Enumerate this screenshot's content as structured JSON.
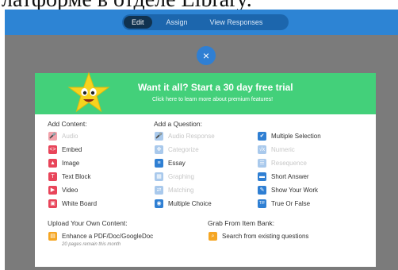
{
  "caption": "латформе в отделе Library.",
  "topbar": {
    "tabs": [
      {
        "label": "Edit",
        "active": true
      },
      {
        "label": "Assign",
        "active": false
      },
      {
        "label": "View Responses",
        "active": false
      }
    ]
  },
  "close_icon": "×",
  "banner": {
    "title": "Want it all? Start a 30 day free trial",
    "subtitle": "Click here to learn more about premium features!",
    "color": "#43d07a"
  },
  "add_content": {
    "label": "Add Content:",
    "items": [
      {
        "label": "Audio",
        "icon": "microphone-icon",
        "glyph": "🎤",
        "disabled": true
      },
      {
        "label": "Embed",
        "icon": "code-icon",
        "glyph": "<>",
        "disabled": false
      },
      {
        "label": "Image",
        "icon": "image-icon",
        "glyph": "▲",
        "disabled": false
      },
      {
        "label": "Text Block",
        "icon": "text-icon",
        "glyph": "T",
        "disabled": false
      },
      {
        "label": "Video",
        "icon": "play-icon",
        "glyph": "▶",
        "disabled": false
      },
      {
        "label": "White Board",
        "icon": "whiteboard-icon",
        "glyph": "▣",
        "disabled": false
      }
    ]
  },
  "add_question": {
    "label": "Add a Question:",
    "col1": [
      {
        "label": "Audio Response",
        "icon": "microphone-icon",
        "glyph": "🎤",
        "disabled": true
      },
      {
        "label": "Categorize",
        "icon": "categorize-icon",
        "glyph": "✥",
        "disabled": true
      },
      {
        "label": "Essay",
        "icon": "essay-icon",
        "glyph": "≡",
        "disabled": false
      },
      {
        "label": "Graphing",
        "icon": "graph-icon",
        "glyph": "▦",
        "disabled": true
      },
      {
        "label": "Matching",
        "icon": "matching-icon",
        "glyph": "⇄",
        "disabled": true
      },
      {
        "label": "Multiple Choice",
        "icon": "radio-icon",
        "glyph": "◉",
        "disabled": false
      }
    ],
    "col2": [
      {
        "label": "Multiple Selection",
        "icon": "checkbox-icon",
        "glyph": "✔",
        "disabled": false
      },
      {
        "label": "Numeric",
        "icon": "sqrt-icon",
        "glyph": "√x",
        "disabled": true
      },
      {
        "label": "Resequence",
        "icon": "resequence-icon",
        "glyph": "☰",
        "disabled": true
      },
      {
        "label": "Short Answer",
        "icon": "short-answer-icon",
        "glyph": "▬",
        "disabled": false
      },
      {
        "label": "Show Your Work",
        "icon": "pencil-icon",
        "glyph": "✎",
        "disabled": false
      },
      {
        "label": "True Or False",
        "icon": "true-false-icon",
        "glyph": "T/F",
        "disabled": false
      }
    ]
  },
  "upload": {
    "label": "Upload Your Own Content:",
    "item": {
      "label": "Enhance a PDF/Doc/GoogleDoc",
      "icon": "document-icon",
      "glyph": "▤"
    },
    "note": "20 pages remain this month"
  },
  "item_bank": {
    "label": "Grab From Item Bank:",
    "item": {
      "label": "Search from existing questions",
      "icon": "search-icon",
      "glyph": "⌕"
    }
  }
}
